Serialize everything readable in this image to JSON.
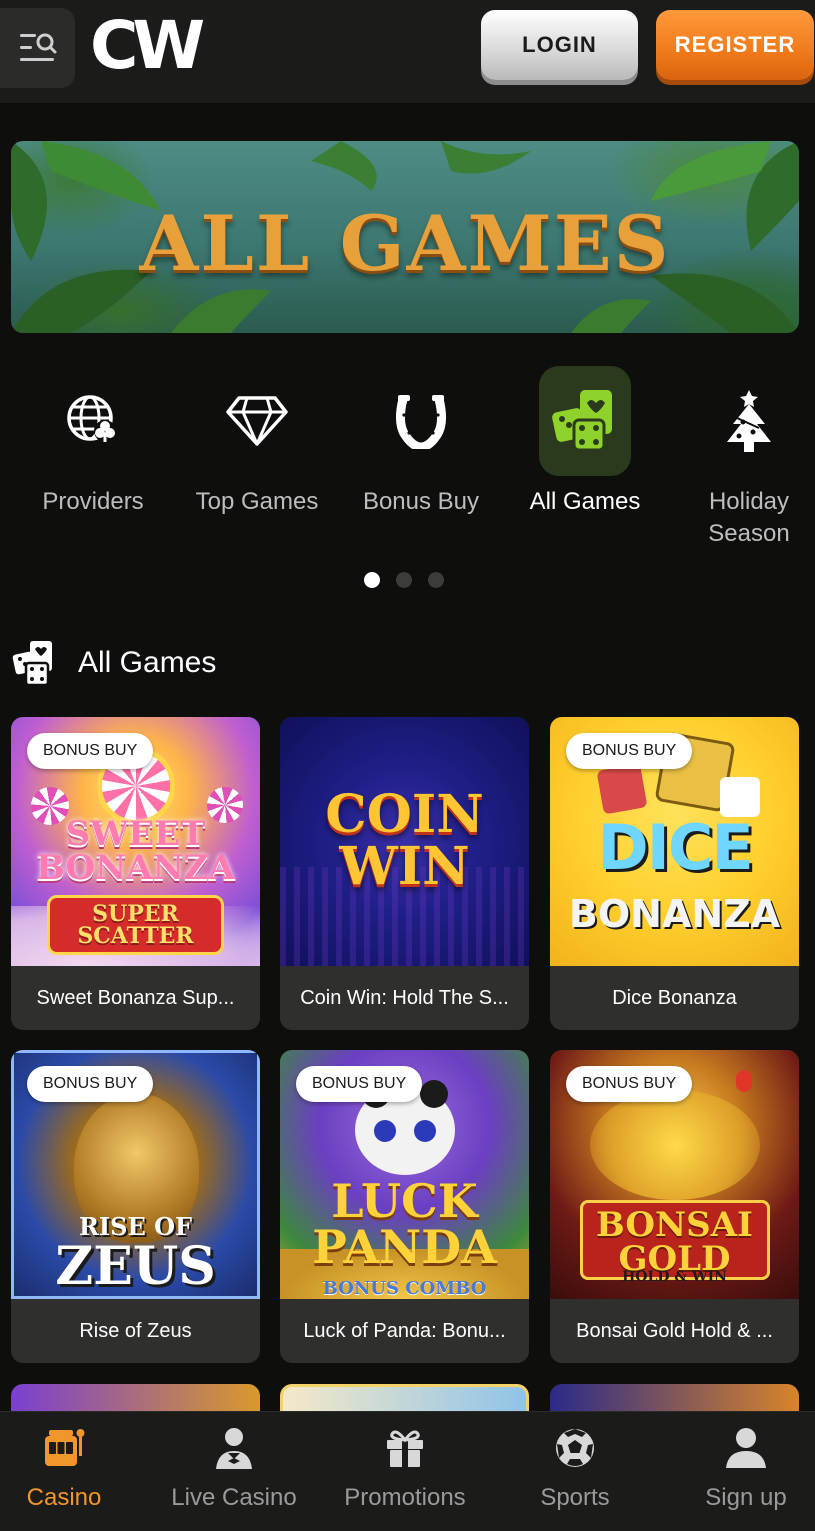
{
  "header": {
    "logo": "CW",
    "login_label": "LOGIN",
    "register_label": "REGISTER"
  },
  "banner": {
    "title": "ALL GAMES"
  },
  "categories": [
    {
      "label": "Providers",
      "icon": "globe-cards-icon",
      "active": false
    },
    {
      "label": "Top Games",
      "icon": "diamond-icon",
      "active": false
    },
    {
      "label": "Bonus Buy",
      "icon": "horseshoe-icon",
      "active": false
    },
    {
      "label": "All Games",
      "icon": "dice-cards-icon",
      "active": true
    },
    {
      "label": "Holiday Season",
      "icon": "christmas-tree-icon",
      "active": false
    }
  ],
  "carousel": {
    "pages": 3,
    "current": 1
  },
  "section": {
    "title": "All Games",
    "icon": "dice-cards-icon"
  },
  "games": [
    {
      "name": "Sweet Bonanza Sup...",
      "badge": "BONUS BUY",
      "art": "SWEET BONANZA SUPER SCATTER"
    },
    {
      "name": "Coin Win: Hold The S...",
      "badge": "",
      "art": "COIN WIN"
    },
    {
      "name": "Dice Bonanza",
      "badge": "BONUS BUY",
      "art": "DICE BONANZA"
    },
    {
      "name": "Rise of Zeus",
      "badge": "BONUS BUY",
      "art": "RISE OF ZEUS"
    },
    {
      "name": "Luck of Panda: Bonu...",
      "badge": "BONUS BUY",
      "art": "LUCK OF PANDA BONUS COMBO"
    },
    {
      "name": "Bonsai Gold Hold & ...",
      "badge": "BONUS BUY",
      "art": "BONSAI GOLD HOLD & WIN"
    }
  ],
  "bottom_nav": [
    {
      "label": "Casino",
      "icon": "slot-machine-icon",
      "active": true
    },
    {
      "label": "Live Casino",
      "icon": "dealer-icon",
      "active": false
    },
    {
      "label": "Promotions",
      "icon": "gift-icon",
      "active": false
    },
    {
      "label": "Sports",
      "icon": "soccer-ball-icon",
      "active": false
    },
    {
      "label": "Sign up",
      "icon": "user-icon",
      "active": false
    }
  ],
  "colors": {
    "accent": "#f0962b",
    "active_tile": "#2b3a1c",
    "lime": "#8fd22b"
  }
}
